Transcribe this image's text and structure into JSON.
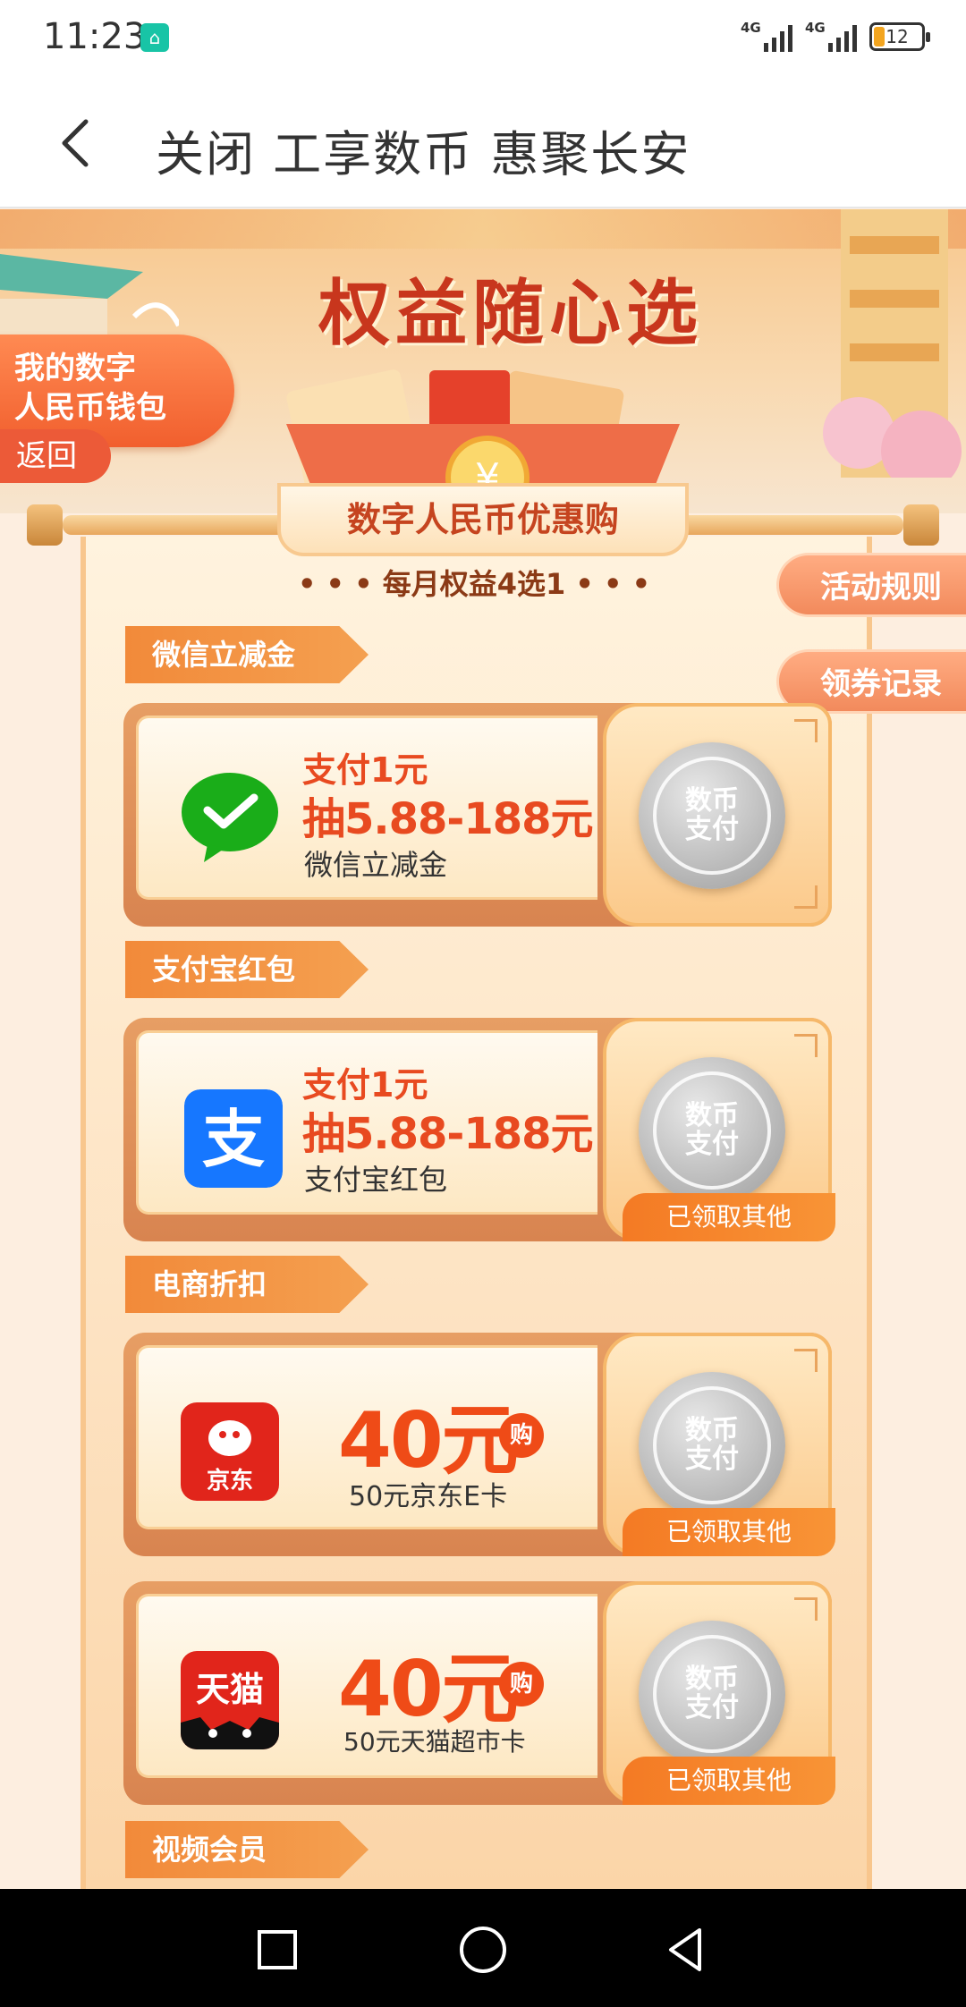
{
  "status_bar": {
    "time": "11:23",
    "app_icon": "home-app-icon",
    "signal1_tag": "4G",
    "signal2_tag": "4G",
    "battery": "12"
  },
  "header": {
    "title": "关闭  工享数币 惠聚长安"
  },
  "banner": {
    "title": "权益随心选",
    "wallet_label_line1": "我的数字",
    "wallet_label_line2": "人民币钱包",
    "back_label": "返回"
  },
  "panel": {
    "ribbon_title": "数字人民币优惠购",
    "monthly_note": "• • •  每月权益4选1  • • •"
  },
  "side_buttons": {
    "rules": "活动规则",
    "records": "领券记录"
  },
  "sections": [
    {
      "tag": "微信立减金"
    },
    {
      "tag": "支付宝红包"
    },
    {
      "tag": "电商折扣"
    },
    {
      "tag": "视频会员"
    }
  ],
  "cards": [
    {
      "logo": "wechat-pay-icon",
      "line1": "支付1元",
      "line2": "抽5.88-188元",
      "line3": "微信立减金",
      "pay_line1": "数币",
      "pay_line2": "支付",
      "claimed": ""
    },
    {
      "logo": "alipay-icon",
      "line1": "支付1元",
      "line2": "抽5.88-188元",
      "line3": "支付宝红包",
      "pay_line1": "数币",
      "pay_line2": "支付",
      "claimed": "已领取其他"
    },
    {
      "logo": "jd-icon",
      "logo_text": "京东",
      "price": "40元",
      "gou": "购",
      "line3": "50元京东E卡",
      "pay_line1": "数币",
      "pay_line2": "支付",
      "claimed": "已领取其他"
    },
    {
      "logo": "tmall-icon",
      "logo_text": "天猫",
      "price": "40元",
      "gou": "购",
      "line3": "50元天猫超市卡",
      "pay_line1": "数币",
      "pay_line2": "支付",
      "claimed": "已领取其他"
    }
  ],
  "colors": {
    "accent_orange": "#f28a3a",
    "price_red": "#ef4b17",
    "wechat_green": "#1aad19",
    "alipay_blue": "#1677ff",
    "jd_red": "#e1251b"
  }
}
